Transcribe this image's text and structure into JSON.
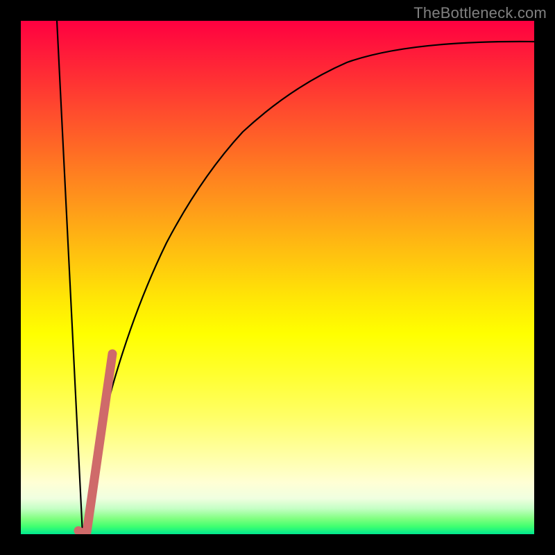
{
  "watermark": "TheBottleneck.com",
  "chart_data": {
    "type": "line",
    "title": "",
    "xlabel": "",
    "ylabel": "",
    "xlim": [
      0,
      100
    ],
    "ylim": [
      0,
      100
    ],
    "grid": false,
    "background": "vertical-gradient red→yellow→green",
    "series": [
      {
        "name": "black-curve",
        "color": "#000000",
        "x": [
          7,
          8,
          9,
          10,
          11,
          12,
          13,
          14,
          15,
          17,
          19,
          21,
          24,
          28,
          33,
          40,
          48,
          58,
          70,
          84,
          100
        ],
        "y": [
          100,
          79,
          58,
          37,
          16,
          0,
          5,
          14,
          23,
          37,
          48,
          56,
          64,
          72,
          78,
          83,
          87,
          90,
          92,
          94,
          95
        ]
      },
      {
        "name": "red-highlight",
        "color": "#d16060",
        "thick": true,
        "x": [
          11.5,
          12,
          12.5,
          13,
          14,
          15,
          16,
          17
        ],
        "y": [
          1,
          0.5,
          0.5,
          1,
          10,
          19,
          27,
          35
        ]
      }
    ]
  }
}
